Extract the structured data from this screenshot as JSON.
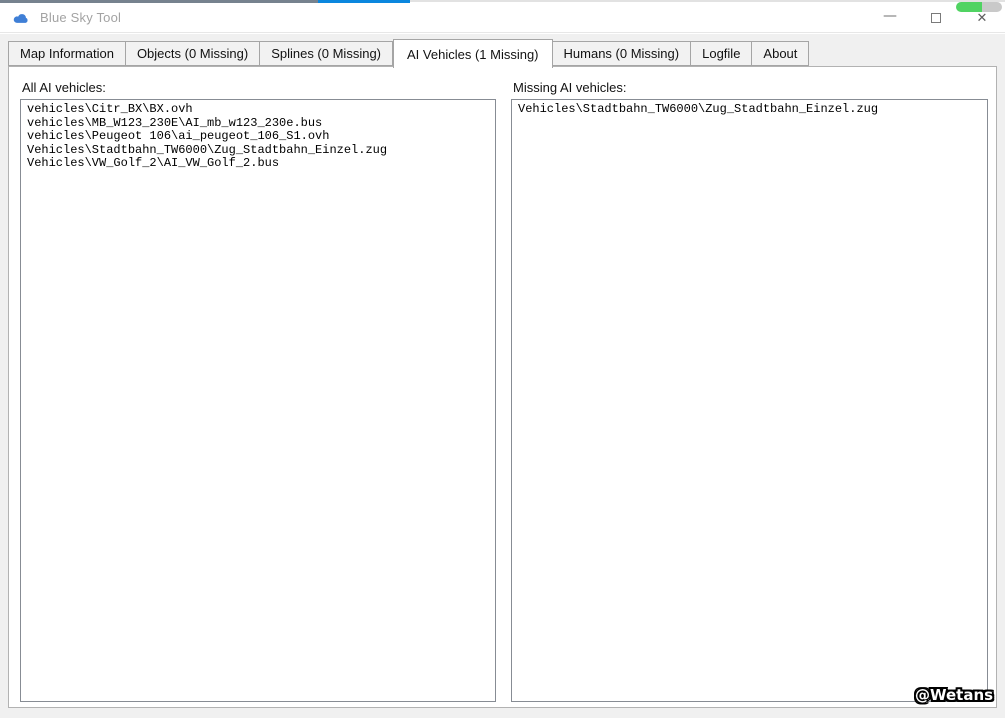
{
  "window": {
    "title": "Blue Sky Tool",
    "minimize_glyph": "—",
    "close_glyph": "✕"
  },
  "tabs": [
    {
      "label": "Map Information",
      "active": false
    },
    {
      "label": "Objects (0 Missing)",
      "active": false
    },
    {
      "label": "Splines (0 Missing)",
      "active": false
    },
    {
      "label": "AI Vehicles (1 Missing)",
      "active": true
    },
    {
      "label": "Humans (0 Missing)",
      "active": false
    },
    {
      "label": "Logfile",
      "active": false
    },
    {
      "label": "About",
      "active": false
    }
  ],
  "all_ai_vehicles": {
    "label": "All AI vehicles:",
    "items": [
      "vehicles\\Citr_BX\\BX.ovh",
      "vehicles\\MB_W123_230E\\AI_mb_w123_230e.bus",
      "vehicles\\Peugeot 106\\ai_peugeot_106_S1.ovh",
      "Vehicles\\Stadtbahn_TW6000\\Zug_Stadtbahn_Einzel.zug",
      "Vehicles\\VW_Golf_2\\AI_VW_Golf_2.bus"
    ]
  },
  "missing_ai_vehicles": {
    "label": "Missing AI vehicles:",
    "items": [
      "Vehicles\\Stadtbahn_TW6000\\Zug_Stadtbahn_Einzel.zug"
    ]
  },
  "watermark": "@Wetans",
  "colors": {
    "top_slate": "#76828e",
    "top_blue": "#0a87de",
    "cloud_icon_blue": "#3f7fd6",
    "pill_green": "#50d362",
    "pill_gray": "#c9c9c9"
  }
}
